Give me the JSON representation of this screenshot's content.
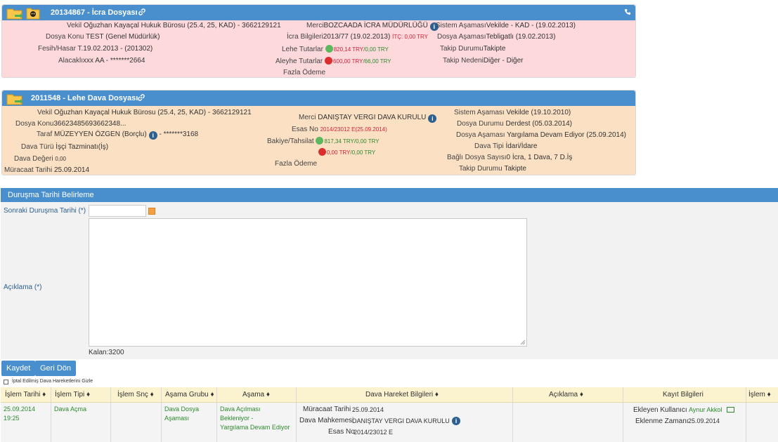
{
  "icra": {
    "title": "20134867 - İcra Dosyası",
    "vekil_label": "Vekil",
    "vekil_value": "Oğuzhan Kayaçal Hukuk Bürosu  (25.4, 25, KAD) - 3662129121",
    "dosya_konu_label": "Dosya Konu",
    "dosya_konu_value": "TEST (Genel Müdürlük)",
    "fesih_label": "Fesih/Hasar T.",
    "fesih_value": "19.02.2013 - (201302)",
    "alacakli_label": "Alacaklı",
    "alacakli_value": "xxx AA - *******2664",
    "merci_label": "Merci",
    "merci_value": "BOZCAADA İCRA MÜDÜRLÜĞÜ",
    "icra_bilgileri_label": "İcra Bilgileri",
    "icra_bilgileri_value": "2013/77 (19.02.2013)",
    "itc_label": "İTÇ:",
    "itc_value": "0,00 TRY",
    "lehe_label": "Lehe Tutarlar",
    "lehe_red": "820,14 TRY",
    "lehe_green": "/0,00 TRY",
    "aleyhe_label": "Aleyhe Tutarlar",
    "aleyhe_red": "600,00 TRY",
    "aleyhe_green": "/66,00 TRY",
    "fazla_odeme_label": "Fazla Ödeme",
    "sistem_asamasi_label": "Sistem Aşaması",
    "sistem_asamasi_value": "Vekilde - KAD - (19.02.2013)",
    "dosya_asamasi_label": "Dosya Aşaması",
    "dosya_asamasi_value": "Tebligatlı (19.02.2013)",
    "takip_durumu_label": "Takip Durumu",
    "takip_durumu_value": "Takipte",
    "takip_nedeni_label": "Takip Nedeni",
    "takip_nedeni_value": "Diğer - Diğer"
  },
  "dava": {
    "title": "2011548 - Lehe Dava Dosyası",
    "vekil_label": "Vekil",
    "vekil_value": "Oğuzhan Kayaçal Hukuk Bürosu  (25.4, 25, KAD) - 3662129121",
    "dosya_konu_label": "Dosya Konu",
    "dosya_konu_value": "36623485693662348...",
    "taraf_label": "Taraf",
    "taraf_value": "MÜZEYYEN ÖZGEN (Borçlu)",
    "taraf_tc": " - *******3168",
    "dava_turu_label": "Dava Türü",
    "dava_turu_value": "İşçi Tazminatı(İş)",
    "dava_degeri_label": "Dava Değeri",
    "dava_degeri_value": "0,00",
    "muracaat_label": "Müracaat Tarihi",
    "muracaat_value": "25.09.2014",
    "merci_label": "Merci",
    "merci_value": "DANIŞTAY VERGI DAVA KURULU",
    "esas_label": "Esas No",
    "esas_value": "2014/23012 E(25.09.2014)",
    "bakiye_label": "Bakiye/Tahsilat",
    "bakiye_green": "817,34 TRY",
    "bakiye_red": "/0,00 TRY",
    "bakiye2_red": "0,00 TRY",
    "bakiye2_green": "/0,00 TRY",
    "fazla_odeme_label": "Fazla Ödeme",
    "sistem_asamasi_label": "Sistem Aşaması",
    "sistem_asamasi_value": "Vekilde (19.10.2010)",
    "dosya_durumu_label": "Dosya Durumu",
    "dosya_durumu_value": "Derdest (05.03.2014)",
    "dosya_asamasi_label": "Dosya Aşaması",
    "dosya_asamasi_value": "Yargılama Devam Ediyor (25.09.2014)",
    "dava_tipi_label": "Dava Tipi",
    "dava_tipi_value": "İdari/İdare",
    "bagli_label": "Bağlı Dosya Sayısı",
    "bagli_value": "0 İcra, 1 Dava, 7 D.İş",
    "takip_durumu_label": "Takip Durumu",
    "takip_durumu_value": "Takipte"
  },
  "form": {
    "section_title": "Duruşma Tarihi Belirleme",
    "sonraki_label": "Sonraki Duruşma Tarihi (*)",
    "aciklama_label": "Açıklama (*)",
    "kalan": "Kalan:3200",
    "save_label": "Kaydet",
    "back_label": "Geri Dön",
    "checkbox_label": "İptal Edilmiş Dava Hareketlerini Gizle"
  },
  "table": {
    "headers": {
      "islem_tarihi": "İşlem Tarihi ♦",
      "islem_tipi": "İşlem Tipi ♦",
      "islem_snc": "İşlem Snç ♦",
      "asama_grubu": "Aşama Grubu ♦",
      "asama": "Aşama ♦",
      "hareket": "Dava Hareket Bilgileri ♦",
      "aciklama": "Açıklama ♦",
      "kayit": "Kayıt Bilgileri",
      "islem": "İşlem ♦"
    },
    "row": {
      "date": "25.09.2014",
      "time": "19:25",
      "islem_tipi": "Dava Açma",
      "asama_grubu_1": "Dava Dosya",
      "asama_grubu_2": "Aşaması",
      "asama_1": "Dava Açılması",
      "asama_2": "Bekleniyor -",
      "asama_3": "Yargılama Devam Ediyor",
      "muracaat_label": "Müracaat Tarihi",
      "muracaat_value": "25.09.2014",
      "mahkeme_label": "Dava Mahkemesi",
      "mahkeme_value": "DANIŞTAY VERGI DAVA KURULU",
      "esas_label": "Esas No",
      "esas_value": "2014/23012 E",
      "ekleyen_label": "Ekleyen Kullanıcı",
      "ekleyen_value": "Aynur Akkol",
      "eklenme_label": "Eklenme Zamanı",
      "eklenme_value": "25.09.2014"
    }
  },
  "colors": {
    "header_blue": "#4a8fcd",
    "icra_bg": "#fdd9dc",
    "dava_bg": "#fbe0c4",
    "table_head_bg": "#fbf2cf"
  }
}
